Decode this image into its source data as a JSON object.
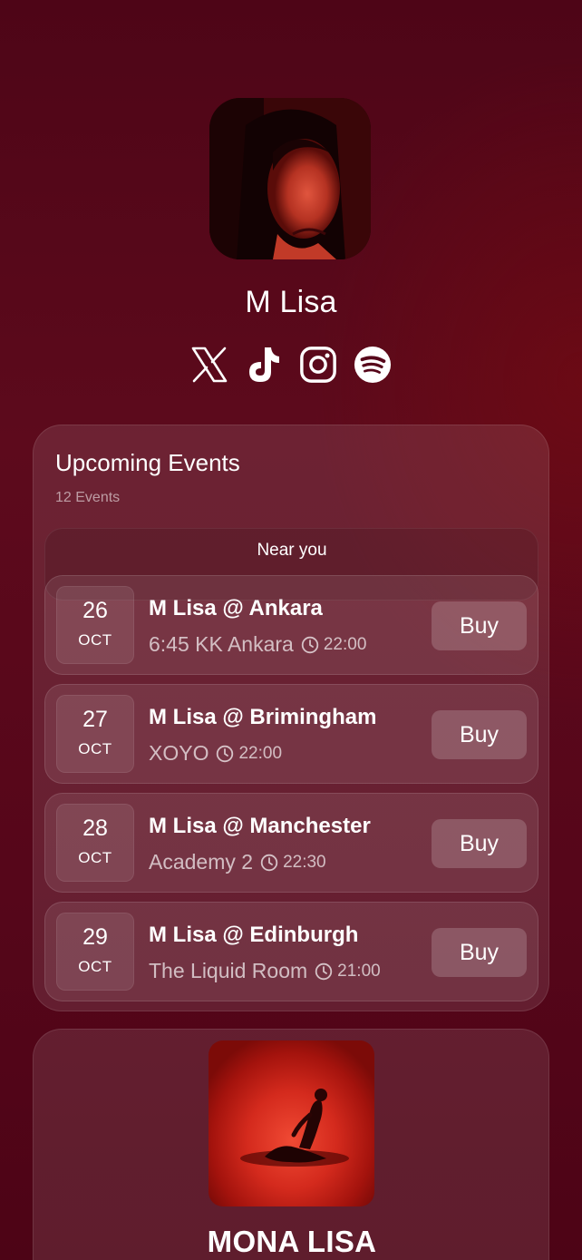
{
  "profile": {
    "name": "M Lisa"
  },
  "socials": [
    {
      "icon": "x-icon"
    },
    {
      "icon": "tiktok-icon"
    },
    {
      "icon": "instagram-icon"
    },
    {
      "icon": "spotify-icon"
    }
  ],
  "events": {
    "title": "Upcoming Events",
    "count": "12 Events",
    "near_you_label": "Near you",
    "items": [
      {
        "day": "26",
        "month": "OCT",
        "title": "M Lisa @ Ankara",
        "venue": "6:45 KK Ankara",
        "time": "22:00",
        "buy_label": "Buy"
      },
      {
        "day": "27",
        "month": "OCT",
        "title": "M Lisa @ Brimingham",
        "venue": "XOYO",
        "time": "22:00",
        "buy_label": "Buy"
      },
      {
        "day": "28",
        "month": "OCT",
        "title": "M Lisa @ Manchester",
        "venue": "Academy 2",
        "time": "22:30",
        "buy_label": "Buy"
      },
      {
        "day": "29",
        "month": "OCT",
        "title": "M Lisa @ Edinburgh",
        "venue": "The Liquid Room",
        "time": "21:00",
        "buy_label": "Buy"
      }
    ]
  },
  "release": {
    "title": "MONA LISA"
  },
  "colors": {
    "background": "#56061a",
    "card": "rgba(255,255,255,0.10)",
    "text": "#ffffff"
  }
}
